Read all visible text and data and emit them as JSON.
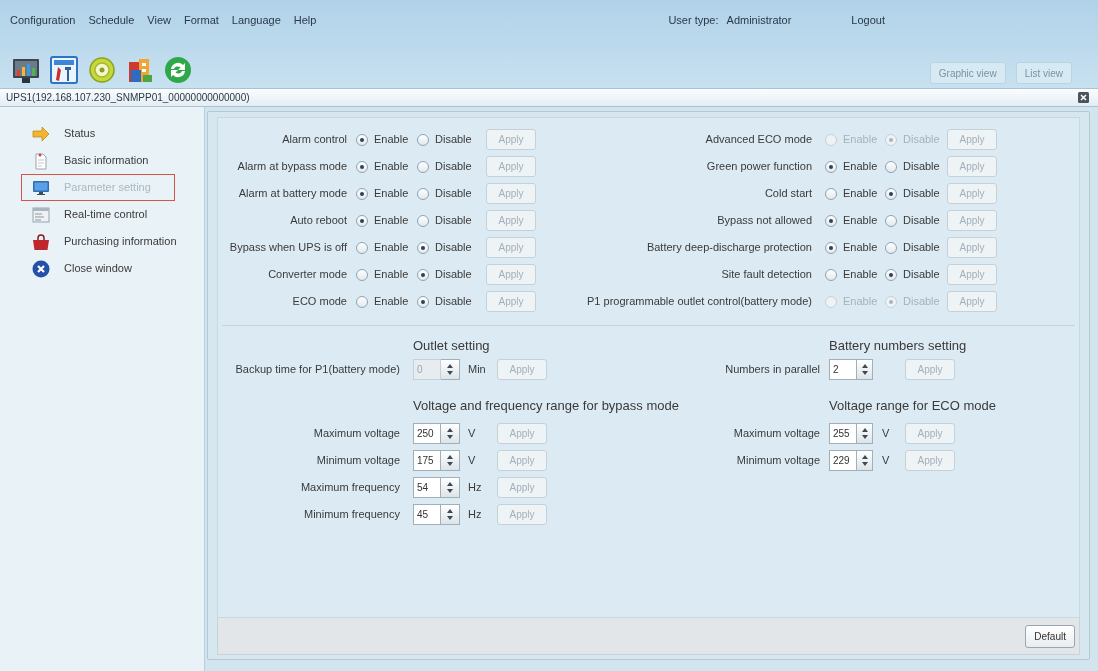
{
  "menu": [
    "Configuration",
    "Schedule",
    "View",
    "Format",
    "Language",
    "Help"
  ],
  "user_type": {
    "label": "User type:",
    "value": "Administrator"
  },
  "logout": "Logout",
  "view_buttons": [
    {
      "label": "Graphic view",
      "disabled": true
    },
    {
      "label": "List view",
      "disabled": true
    }
  ],
  "device_title": "UPS1(192.168.107.230_SNMPP01_00000000000000)",
  "sidebar": {
    "items": [
      {
        "label": "Status",
        "selected": false
      },
      {
        "label": "Basic information",
        "selected": false
      },
      {
        "label": "Parameter setting",
        "selected": true
      },
      {
        "label": "Real-time control",
        "selected": false
      },
      {
        "label": "Purchasing information",
        "selected": false
      },
      {
        "label": "Close window",
        "selected": false
      }
    ]
  },
  "switch_settings": {
    "left": [
      {
        "label": "Alarm control",
        "disabled": false,
        "options": [
          {
            "label": "Enable",
            "selected": true
          },
          {
            "label": "Disable",
            "selected": false
          }
        ],
        "apply": {
          "label": "Apply",
          "disabled": true
        }
      },
      {
        "label": "Alarm at bypass mode",
        "disabled": false,
        "options": [
          {
            "label": "Enable",
            "selected": true
          },
          {
            "label": "Disable",
            "selected": false
          }
        ],
        "apply": {
          "label": "Apply",
          "disabled": true
        }
      },
      {
        "label": "Alarm at battery mode",
        "disabled": false,
        "options": [
          {
            "label": "Enable",
            "selected": true
          },
          {
            "label": "Disable",
            "selected": false
          }
        ],
        "apply": {
          "label": "Apply",
          "disabled": true
        }
      },
      {
        "label": "Auto reboot",
        "disabled": false,
        "options": [
          {
            "label": "Enable",
            "selected": true
          },
          {
            "label": "Disable",
            "selected": false
          }
        ],
        "apply": {
          "label": "Apply",
          "disabled": true
        }
      },
      {
        "label": "Bypass when UPS is off",
        "disabled": false,
        "options": [
          {
            "label": "Enable",
            "selected": false
          },
          {
            "label": "Disable",
            "selected": true
          }
        ],
        "apply": {
          "label": "Apply",
          "disabled": true
        }
      },
      {
        "label": "Converter mode",
        "disabled": false,
        "options": [
          {
            "label": "Enable",
            "selected": false
          },
          {
            "label": "Disable",
            "selected": true
          }
        ],
        "apply": {
          "label": "Apply",
          "disabled": true
        }
      },
      {
        "label": "ECO mode",
        "disabled": false,
        "options": [
          {
            "label": "Enable",
            "selected": false
          },
          {
            "label": "Disable",
            "selected": true
          }
        ],
        "apply": {
          "label": "Apply",
          "disabled": true
        }
      }
    ],
    "right": [
      {
        "label": "Advanced ECO mode",
        "disabled": true,
        "options": [
          {
            "label": "Enable",
            "selected": false
          },
          {
            "label": "Disable",
            "selected": true
          }
        ],
        "apply": {
          "label": "Apply",
          "disabled": true
        }
      },
      {
        "label": "Green power function",
        "disabled": false,
        "options": [
          {
            "label": "Enable",
            "selected": true
          },
          {
            "label": "Disable",
            "selected": false
          }
        ],
        "apply": {
          "label": "Apply",
          "disabled": true
        }
      },
      {
        "label": "Cold start",
        "disabled": false,
        "options": [
          {
            "label": "Enable",
            "selected": false
          },
          {
            "label": "Disable",
            "selected": true
          }
        ],
        "apply": {
          "label": "Apply",
          "disabled": true
        }
      },
      {
        "label": "Bypass not allowed",
        "disabled": false,
        "options": [
          {
            "label": "Enable",
            "selected": true
          },
          {
            "label": "Disable",
            "selected": false
          }
        ],
        "apply": {
          "label": "Apply",
          "disabled": true
        }
      },
      {
        "label": "Battery deep-discharge protection",
        "disabled": false,
        "options": [
          {
            "label": "Enable",
            "selected": true
          },
          {
            "label": "Disable",
            "selected": false
          }
        ],
        "apply": {
          "label": "Apply",
          "disabled": true
        }
      },
      {
        "label": "Site fault detection",
        "disabled": false,
        "options": [
          {
            "label": "Enable",
            "selected": false
          },
          {
            "label": "Disable",
            "selected": true
          }
        ],
        "apply": {
          "label": "Apply",
          "disabled": true
        }
      },
      {
        "label": "P1 programmable outlet control(battery mode)",
        "disabled": true,
        "options": [
          {
            "label": "Enable",
            "selected": false
          },
          {
            "label": "Disable",
            "selected": true
          }
        ],
        "apply": {
          "label": "Apply",
          "disabled": true
        }
      }
    ]
  },
  "outlet_setting": {
    "title": "Outlet setting",
    "fields": [
      {
        "label": "Backup time for P1(battery mode)",
        "value": "0",
        "unit": "Min",
        "disabled": true,
        "apply": {
          "label": "Apply",
          "disabled": true
        }
      }
    ]
  },
  "bypass_range": {
    "title": "Voltage and frequency range for bypass mode",
    "fields": [
      {
        "label": "Maximum voltage",
        "value": "250",
        "unit": "V",
        "disabled": false,
        "apply": {
          "label": "Apply",
          "disabled": true
        }
      },
      {
        "label": "Minimum voltage",
        "value": "175",
        "unit": "V",
        "disabled": false,
        "apply": {
          "label": "Apply",
          "disabled": true
        }
      },
      {
        "label": "Maximum frequency",
        "value": "54",
        "unit": "Hz",
        "disabled": false,
        "apply": {
          "label": "Apply",
          "disabled": true
        }
      },
      {
        "label": "Minimum frequency",
        "value": "45",
        "unit": "Hz",
        "disabled": false,
        "apply": {
          "label": "Apply",
          "disabled": true
        }
      }
    ]
  },
  "battery_numbers": {
    "title": "Battery numbers setting",
    "fields": [
      {
        "label": "Numbers in parallel",
        "value": "2",
        "disabled": false,
        "apply": {
          "label": "Apply",
          "disabled": true
        }
      }
    ]
  },
  "eco_range": {
    "title": "Voltage range for ECO mode",
    "fields": [
      {
        "label": "Maximum voltage",
        "value": "255",
        "unit": "V",
        "disabled": false,
        "apply": {
          "label": "Apply",
          "disabled": true
        }
      },
      {
        "label": "Minimum voltage",
        "value": "229",
        "unit": "V",
        "disabled": false,
        "apply": {
          "label": "Apply",
          "disabled": true
        }
      }
    ]
  },
  "default_button": "Default"
}
